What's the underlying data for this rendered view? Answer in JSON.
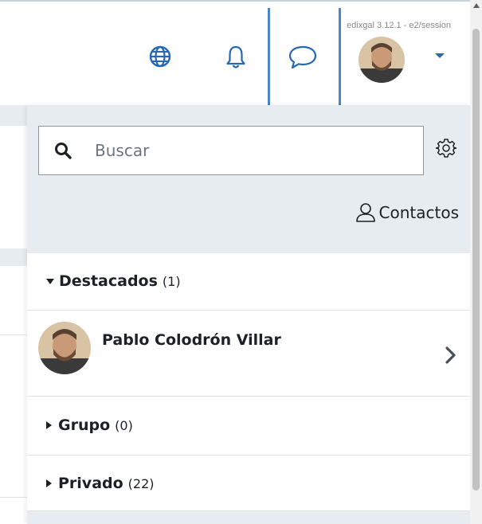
{
  "header": {
    "version": "edixgal 3.12.1 - e2/session",
    "icons": {
      "language": "globe-icon",
      "notifications": "bell-icon",
      "messages": "chat-icon",
      "user_menu": "caret-down-icon"
    }
  },
  "messages_drawer": {
    "search": {
      "placeholder": "Buscar",
      "value": ""
    },
    "contacts_label": "Contactos",
    "sections": {
      "starred": {
        "label": "Destacados",
        "count": "(1)",
        "expanded": true
      },
      "group": {
        "label": "Grupo",
        "count": "(0)",
        "expanded": false
      },
      "private": {
        "label": "Privado",
        "count": "(22)",
        "expanded": false
      }
    },
    "starred_conversations": [
      {
        "name": "Pablo Colodrón Villar"
      }
    ]
  },
  "colors": {
    "accent": "#4a86c8",
    "drawer_header_bg": "#e7ecf1",
    "text": "#1d2125"
  }
}
